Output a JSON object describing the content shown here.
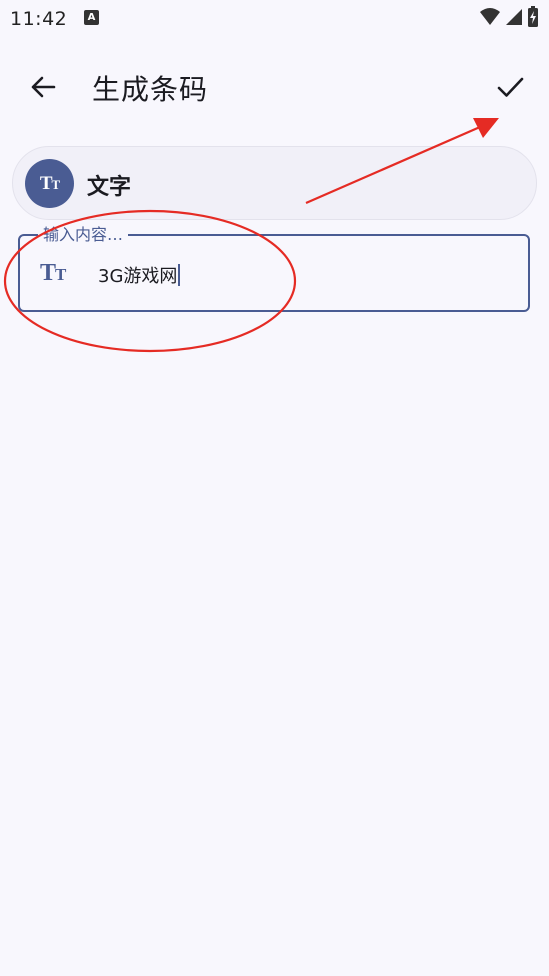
{
  "status_bar": {
    "time": "11:42",
    "notification_icon": "A"
  },
  "app_bar": {
    "title": "生成条码",
    "back_icon": "arrow-left-icon",
    "confirm_icon": "check-icon"
  },
  "type_chip": {
    "icon": "text-format-icon",
    "label": "文字"
  },
  "input": {
    "label": "输入内容…",
    "value": "3G游戏网",
    "icon": "text-format-icon"
  },
  "colors": {
    "primary": "#4a5c93",
    "background": "#f8f7fd",
    "annotation": "#e52b24"
  }
}
